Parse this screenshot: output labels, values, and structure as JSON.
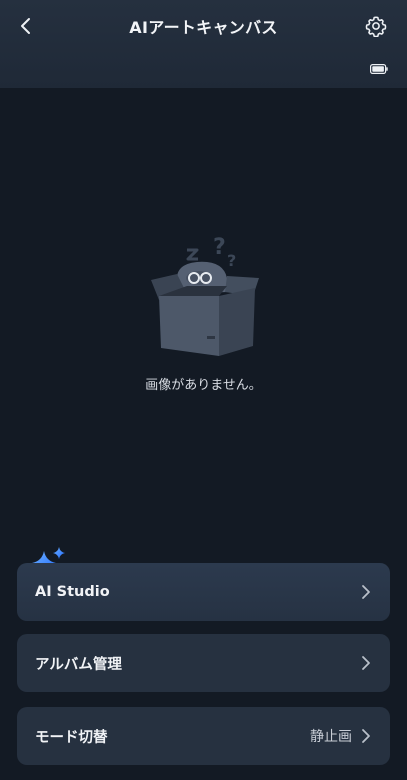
{
  "header": {
    "title": "AIアートキャンバス",
    "back_icon": "chevron-left-icon",
    "settings_icon": "gear-icon",
    "battery_icon": "battery-icon"
  },
  "empty_state": {
    "message": "画像がありません。",
    "illustration": "empty-box-robot"
  },
  "menu": {
    "studio": {
      "label": "AI Studio",
      "icon": "sparkle-icon"
    },
    "album": {
      "label": "アルバム管理"
    },
    "mode": {
      "label": "モード切替",
      "value": "静止画"
    }
  },
  "colors": {
    "background": "#131a24",
    "header": "#222c3a",
    "card": "#263140",
    "accent": "#3b8cff"
  }
}
